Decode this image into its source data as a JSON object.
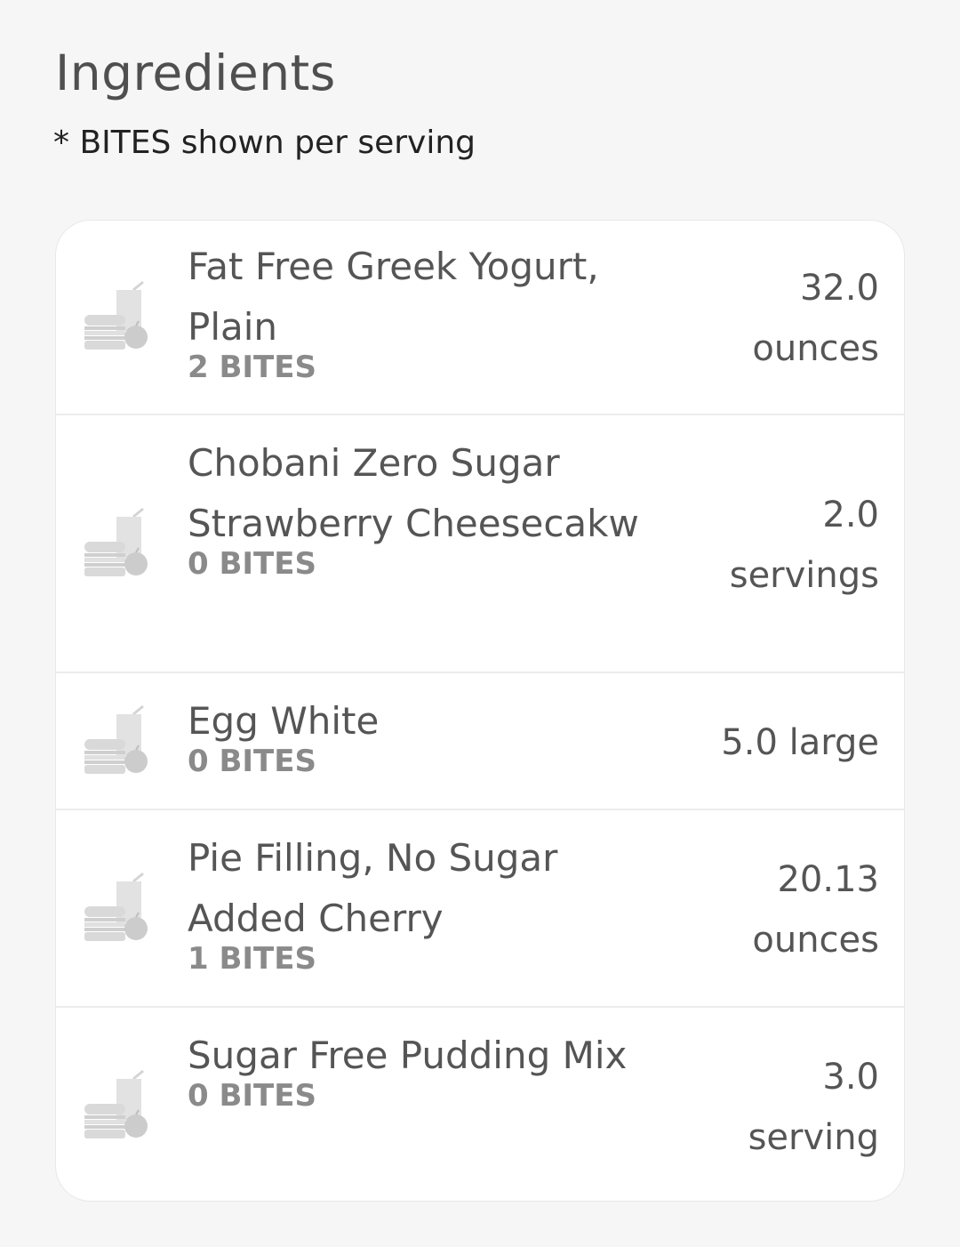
{
  "header": {
    "title": "Ingredients",
    "subtitle": "* BITES shown per serving"
  },
  "ingredients": [
    {
      "icon": "food-icon",
      "name": "Fat Free Greek Yogurt, Plain",
      "bites": "2 BITES",
      "qty_amount": "32.0",
      "qty_unit": "ounces"
    },
    {
      "icon": "food-icon",
      "name": "Chobani Zero Sugar Strawberry Cheesecakw",
      "bites": "0 BITES",
      "qty_amount": "2.0",
      "qty_unit": "servings"
    },
    {
      "icon": "food-icon",
      "name": "Egg White",
      "bites": "0 BITES",
      "qty_amount": "5.0",
      "qty_unit": "large"
    },
    {
      "icon": "food-icon",
      "name": "Pie Filling, No Sugar Added Cherry",
      "bites": "1 BITES",
      "qty_amount": "20.13",
      "qty_unit": "ounces"
    },
    {
      "icon": "food-icon",
      "name": "Sugar Free Pudding Mix",
      "bites": "0 BITES",
      "qty_amount": "3.0",
      "qty_unit": "serving"
    }
  ]
}
